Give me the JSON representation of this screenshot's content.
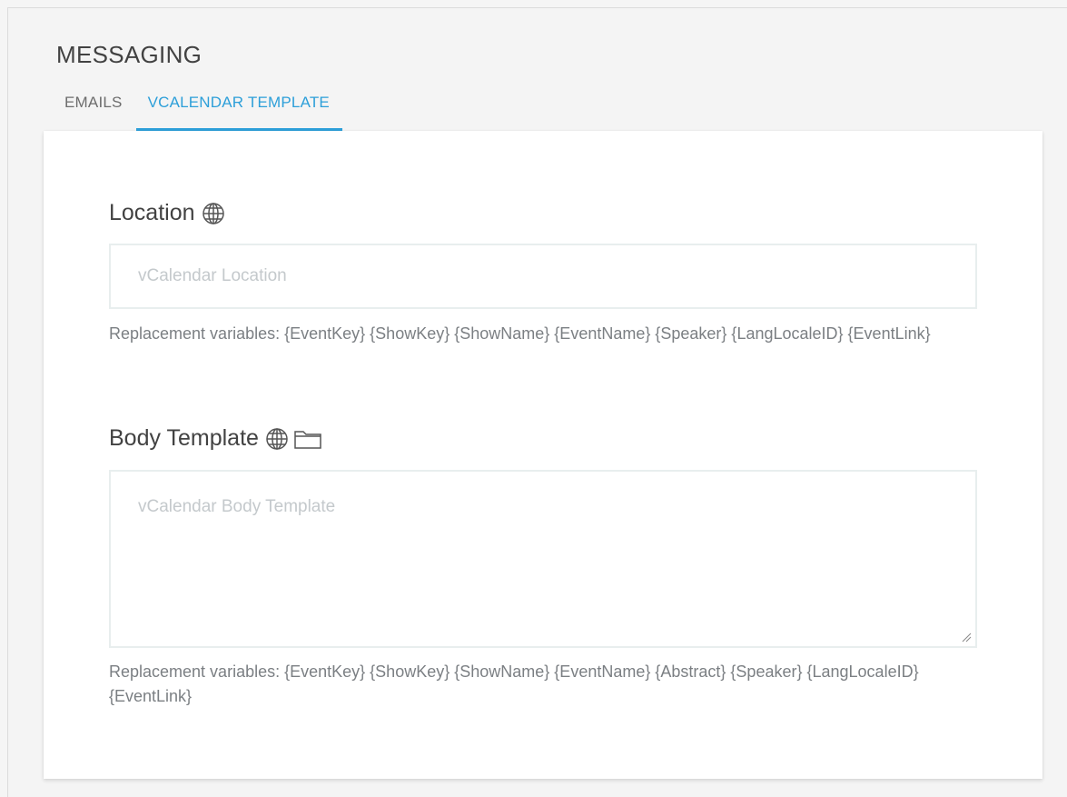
{
  "section": {
    "title": "MESSAGING"
  },
  "tabs": [
    {
      "label": "EMAILS",
      "active": false
    },
    {
      "label": "VCALENDAR TEMPLATE",
      "active": true
    }
  ],
  "colors": {
    "accent": "#2d9fd9",
    "text_primary": "#424242",
    "text_hint": "#7b7f83",
    "placeholder": "#c4c9cc"
  },
  "location": {
    "label": "Location",
    "icons": [
      "globe-icon"
    ],
    "placeholder": "vCalendar Location",
    "value": "",
    "hint": "Replacement variables: {EventKey} {ShowKey} {ShowName} {EventName} {Speaker} {LangLocaleID} {EventLink}"
  },
  "body_template": {
    "label": "Body Template",
    "icons": [
      "globe-icon",
      "folder-icon"
    ],
    "placeholder": "vCalendar Body Template",
    "value": "",
    "hint": "Replacement variables: {EventKey} {ShowKey} {ShowName} {EventName} {Abstract} {Speaker} {LangLocaleID} {EventLink}"
  }
}
